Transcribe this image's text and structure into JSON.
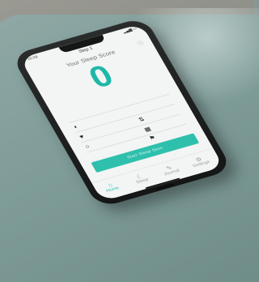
{
  "photo": {
    "status_time": "10:28",
    "step_title": "Step 1",
    "screen_title": "Your Sleep Score",
    "score": "0",
    "primary_button": "Start Sleep Sess",
    "tabs": [
      "Home",
      "Sleep",
      "Journal",
      "Settings"
    ]
  }
}
